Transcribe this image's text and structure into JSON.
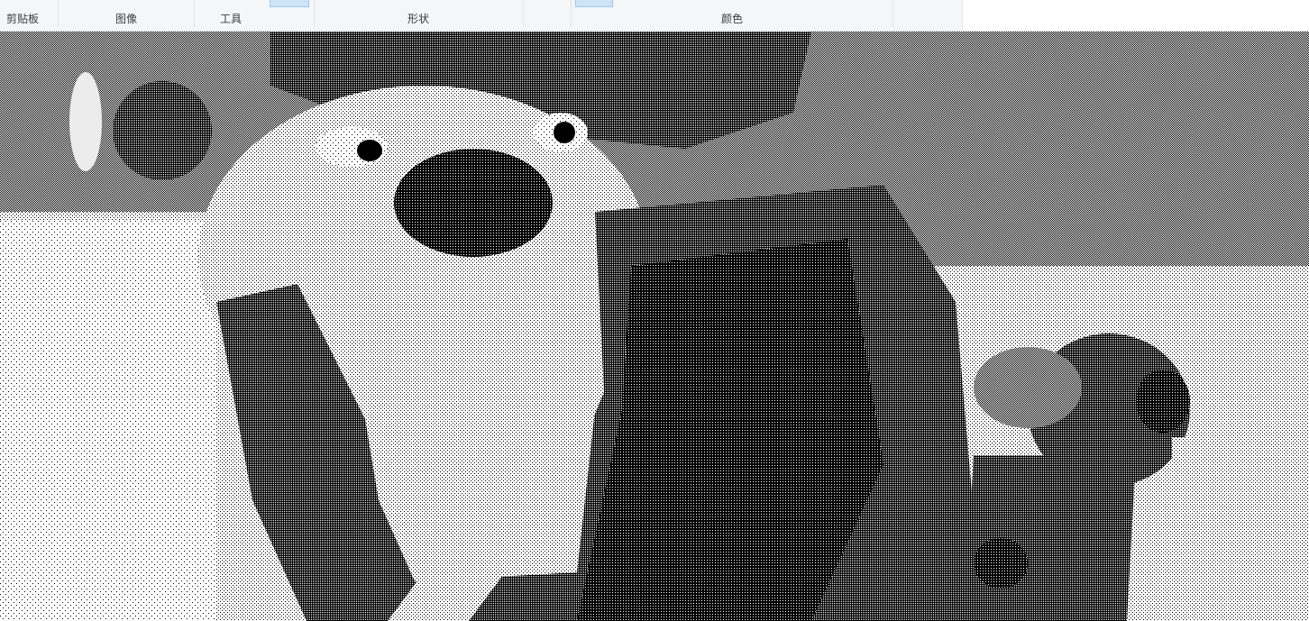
{
  "ribbon": {
    "groups": [
      {
        "id": "clipboard",
        "label": "剪贴板"
      },
      {
        "id": "image",
        "label": "图像"
      },
      {
        "id": "tools",
        "label": "工具"
      },
      {
        "id": "shapes",
        "label": "形状"
      },
      {
        "id": "colors",
        "label": "颜色"
      }
    ]
  },
  "canvas": {
    "description_icon": "image-canvas",
    "dither_colors": {
      "fg": "#000000",
      "bg": "#ffffff"
    }
  }
}
